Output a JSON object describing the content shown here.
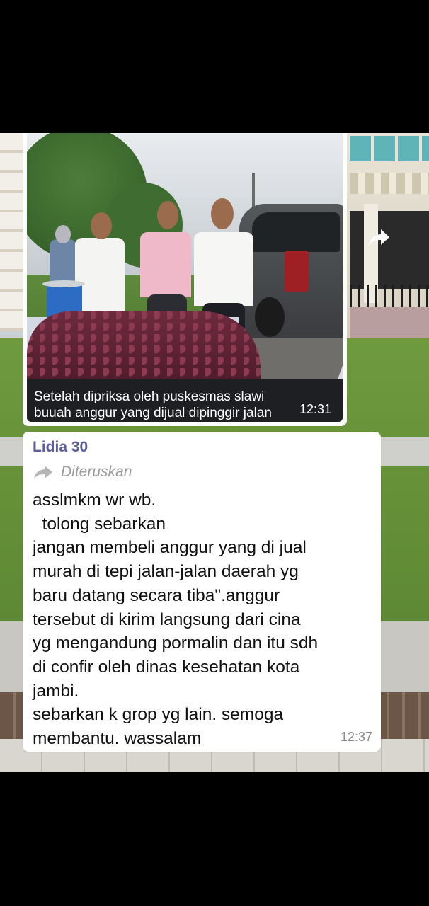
{
  "chat": {
    "image_message": {
      "caption_line1": "Setelah dipriksa oleh puskesmas slawi",
      "caption_line2": "buuah anggur yang dijual dipinggir jalan",
      "time": "12:31"
    },
    "text_message": {
      "sender": "Lidia 30",
      "forwarded_label": "Diteruskan",
      "body": "asslmkm wr wb.\n  tolong sebarkan\njangan membeli anggur yang di jual\nmurah di tepi jalan-jalan daerah yg\nbaru datang secara tiba\".anggur\ntersebut di kirim langsung dari cina\nyg mengandung pormalin dan itu sdh\ndi confir oleh dinas kesehatan kota\njambi.\nsebarkan k grop yg lain. semoga\nmembantu. wassalam",
      "time": "12:37"
    },
    "icons": {
      "share": "share-arrow-icon",
      "forwarded": "forward-arrow-icon"
    }
  },
  "colors": {
    "sender_name": "#5b5ea0",
    "bubble": "#ffffff",
    "meta_text": "#8a8a8a"
  }
}
